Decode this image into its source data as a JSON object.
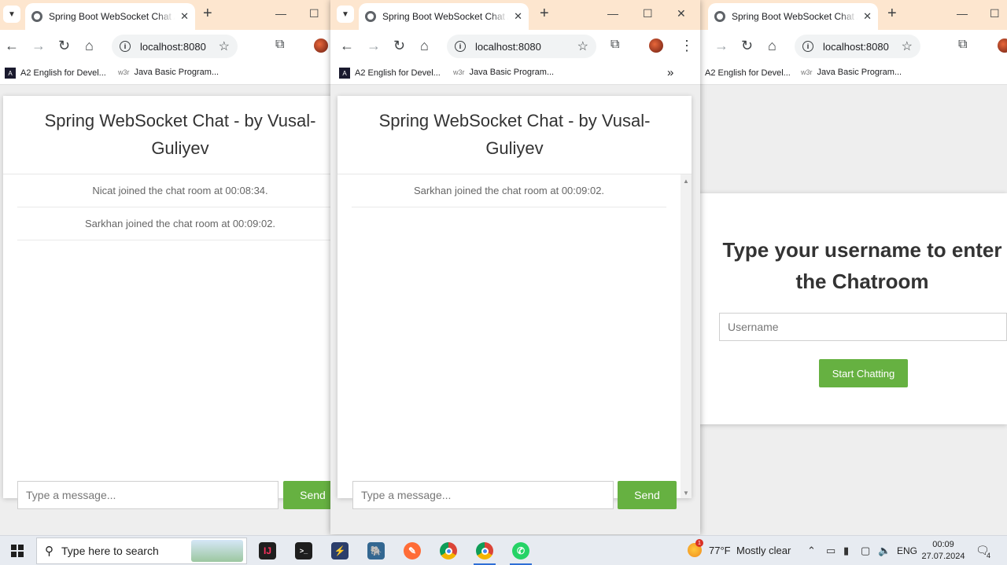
{
  "browser": {
    "tab_title": "Spring Boot WebSocket Chat Ap",
    "url": "localhost:8080",
    "bookmarks": [
      "A2 English for Devel...",
      "Java Basic Program..."
    ],
    "bookmark_icon_1": "A",
    "bookmark_icon_2": "w3r"
  },
  "chat": {
    "title": "Spring WebSocket Chat - by Vusal-Guliyev",
    "input_placeholder": "Type a message...",
    "send_label": "Send",
    "window_a_messages": [
      "Nicat joined the chat room at 00:08:34.",
      "Sarkhan joined the chat room at 00:09:02."
    ],
    "window_b_messages": [
      "Sarkhan joined the chat room at 00:09:02."
    ]
  },
  "login": {
    "title": "Type your username to enter the Chatroom",
    "username_placeholder": "Username",
    "button_label": "Start Chatting"
  },
  "taskbar": {
    "search_placeholder": "Type here to search",
    "weather_temp": "77°F",
    "weather_desc": "Mostly clear",
    "weather_badge": "1",
    "language": "ENG",
    "time": "00:09",
    "date": "27.07.2024",
    "notification_count": "4"
  },
  "colors": {
    "tabstrip": "#fde6cf",
    "send_button": "#66b141"
  }
}
